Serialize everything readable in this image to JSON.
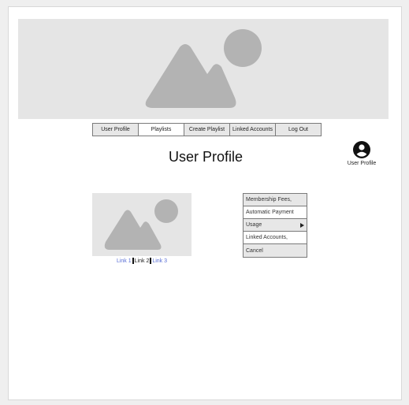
{
  "nav": {
    "items": [
      {
        "label": "User Profile",
        "active": false
      },
      {
        "label": "Playlists",
        "active": true
      },
      {
        "label": "Create Playlist",
        "active": false
      },
      {
        "label": "Linked Accounts",
        "active": false
      },
      {
        "label": "Log Out",
        "active": false
      }
    ]
  },
  "page": {
    "title": "User Profile"
  },
  "profile": {
    "label": "User Profile",
    "icon": "user-circle-icon"
  },
  "links": [
    "Link 1",
    "Link 2",
    "Link 3"
  ],
  "menu": {
    "items": [
      {
        "label": "Membership Fees,",
        "has_submenu": false
      },
      {
        "label": "Automatic Payment",
        "has_submenu": false
      },
      {
        "label": "Usage",
        "has_submenu": true
      },
      {
        "label": "Linked Accounts,",
        "has_submenu": false
      },
      {
        "label": "Cancel",
        "has_submenu": false
      }
    ]
  },
  "colors": {
    "placeholder_bg": "#e5e5e5",
    "placeholder_shape": "#b3b3b3",
    "link": "#5a6fd6"
  }
}
